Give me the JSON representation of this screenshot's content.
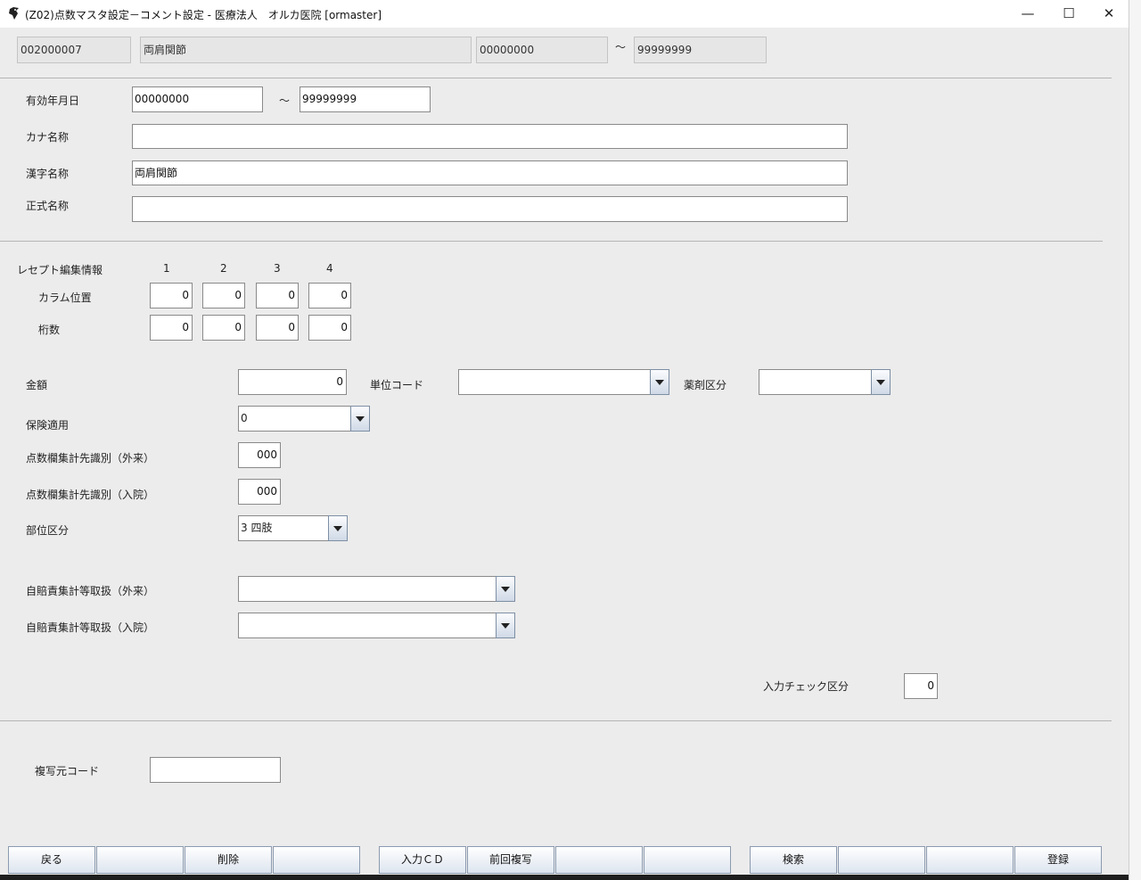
{
  "window": {
    "title": "(Z02)点数マスタ設定－コメント設定 - 医療法人　オルカ医院  [ormaster]",
    "minimize_glyph": "—",
    "maximize_glyph": "☐",
    "close_glyph": "✕"
  },
  "header": {
    "code": "002000007",
    "name": "両肩関節",
    "start": "00000000",
    "tilde": "～",
    "end": "99999999"
  },
  "form": {
    "valid_date": {
      "label": "有効年月日",
      "start": "00000000",
      "tilde": "～",
      "end": "99999999"
    },
    "kana_name": {
      "label": "カナ名称",
      "value": ""
    },
    "kanji_name": {
      "label": "漢字名称",
      "value": "両肩関節"
    },
    "formal_name": {
      "label": "正式名称",
      "value": ""
    }
  },
  "receipt": {
    "title": "レセプト編集情報",
    "columns": [
      "1",
      "2",
      "3",
      "4"
    ],
    "column_pos_label": "カラム位置",
    "column_pos_values": [
      "0",
      "0",
      "0",
      "0"
    ],
    "digits_label": "桁数",
    "digits_values": [
      "0",
      "0",
      "0",
      "0"
    ]
  },
  "details": {
    "amount_label": "金額",
    "amount_value": "0",
    "unit_code_label": "単位コード",
    "unit_code_value": "",
    "drug_category_label": "薬剤区分",
    "drug_category_value": "",
    "insurance_label": "保険適用",
    "insurance_value": "0",
    "outpatient_total_label": "点数欄集計先識別（外来）",
    "outpatient_total_value": "000",
    "inpatient_total_label": "点数欄集計先識別（入院）",
    "inpatient_total_value": "000",
    "site_label": "部位区分",
    "site_value": "3 四肢",
    "jibai_out_label": "自賠責集計等取扱（外来）",
    "jibai_out_value": "",
    "jibai_in_label": "自賠責集計等取扱（入院）",
    "jibai_in_value": "",
    "input_check_label": "入力チェック区分",
    "input_check_value": "0"
  },
  "copy_source": {
    "label": "複写元コード",
    "value": ""
  },
  "function_keys": [
    "戻る",
    "",
    "削除",
    "",
    "入力ＣＤ",
    "前回複写",
    "",
    "",
    "検索",
    "",
    "",
    "登録"
  ]
}
